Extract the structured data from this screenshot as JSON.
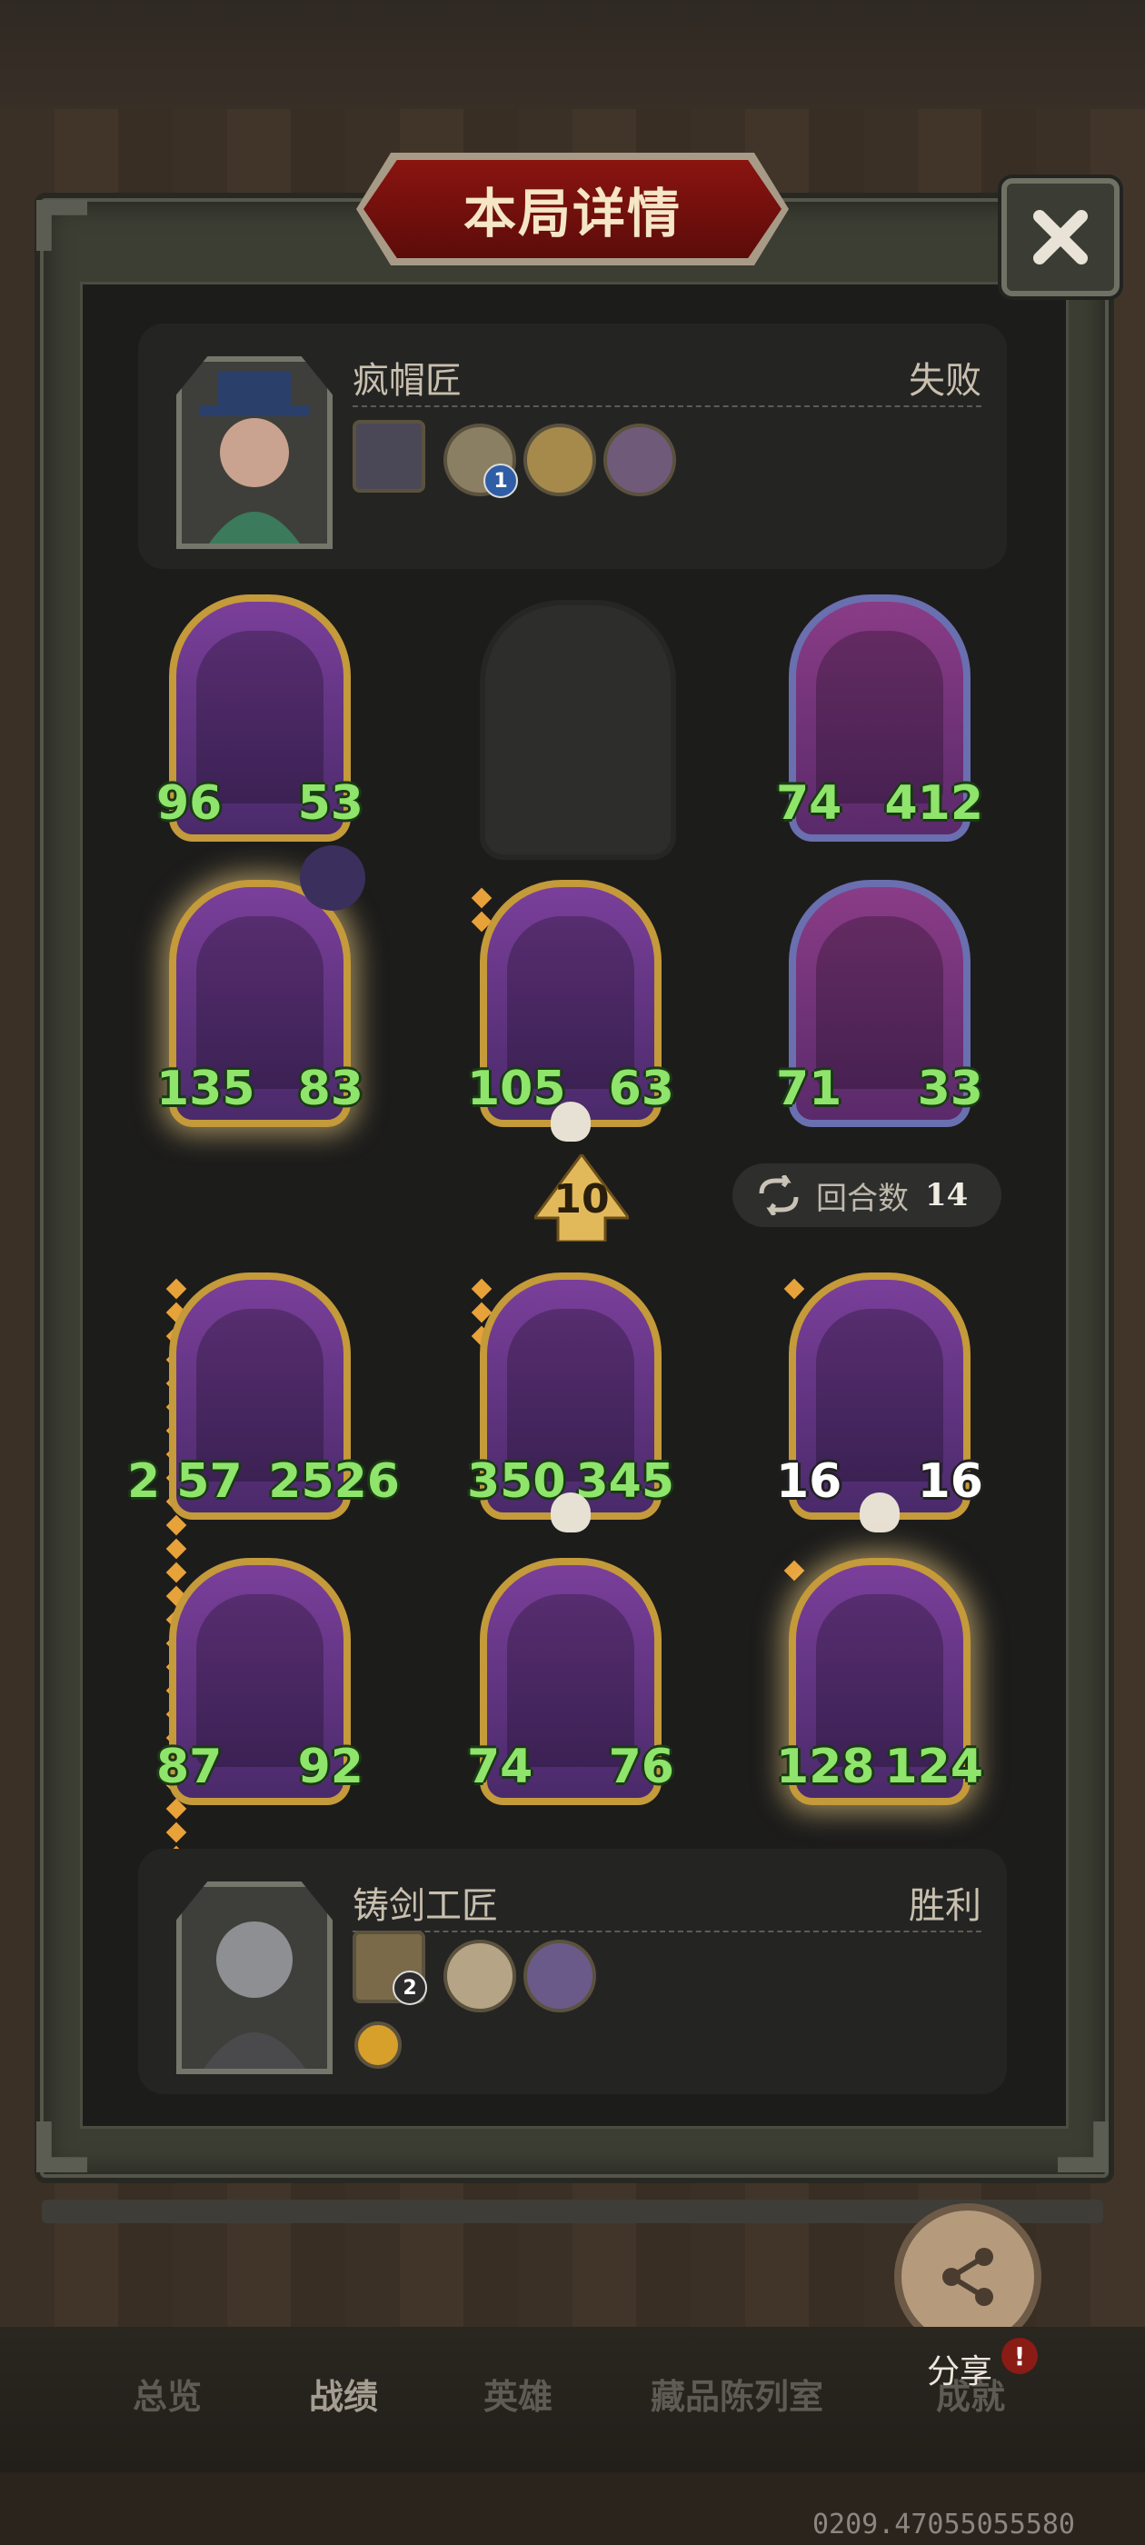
{
  "header": {
    "title": "本局详情"
  },
  "close_icon": "close-icon",
  "opponent": {
    "name": "疯帽匠",
    "result": "失败",
    "relic_badge": "1"
  },
  "me": {
    "name": "铸剑工匠",
    "result": "胜利",
    "relic_badge": "2"
  },
  "board_top": [
    {
      "atk": "96",
      "hp": "53"
    },
    {
      "atk": "74",
      "hp": "412"
    },
    {
      "atk": "135",
      "hp": "83"
    },
    {
      "atk": "105",
      "hp": "63"
    },
    {
      "atk": "71",
      "hp": "33"
    }
  ],
  "damage_marker": "10",
  "round": {
    "label": "回合数",
    "value": "14"
  },
  "board_bottom": [
    {
      "atk": "2 57",
      "hp": "2526"
    },
    {
      "atk": "350",
      "hp": "345"
    },
    {
      "atk": "16",
      "hp": "16"
    },
    {
      "atk": "87",
      "hp": "92"
    },
    {
      "atk": "74",
      "hp": "76"
    },
    {
      "atk": "128",
      "hp": "124"
    }
  ],
  "share": {
    "label": "分享",
    "alert": "!"
  },
  "nav": [
    "总览",
    "战绩",
    "英雄",
    "藏品陈列室",
    "成就"
  ],
  "coords": "0209.47055055580",
  "colors": {
    "accent_red": "#8a1410",
    "stat_green": "#8fe46b",
    "frame_gold": "#c49a3a"
  }
}
